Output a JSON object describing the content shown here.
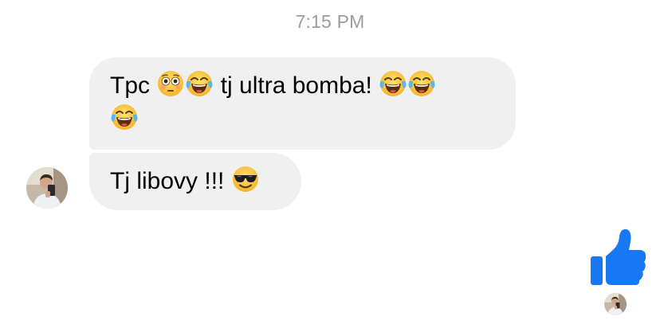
{
  "thread": {
    "timestamp": "7:15 PM"
  },
  "messages": [
    {
      "text_1": "Tpc",
      "emoji_1": "flushed-face",
      "emoji_2": "face-with-tears-of-joy",
      "text_2": "tj ultra bomba!",
      "emoji_3": "face-with-tears-of-joy",
      "emoji_4": "face-with-tears-of-joy",
      "emoji_5": "face-with-tears-of-joy"
    },
    {
      "text_1": "Tj libovy !!!",
      "emoji_1": "smiling-face-with-sunglasses"
    }
  ],
  "reaction": {
    "icon": "thumbs-up-icon",
    "color": "#1877f2"
  },
  "colors": {
    "bubble_background": "#f1f0f0",
    "timestamp": "#9c9ca1",
    "accent": "#1877f2"
  }
}
